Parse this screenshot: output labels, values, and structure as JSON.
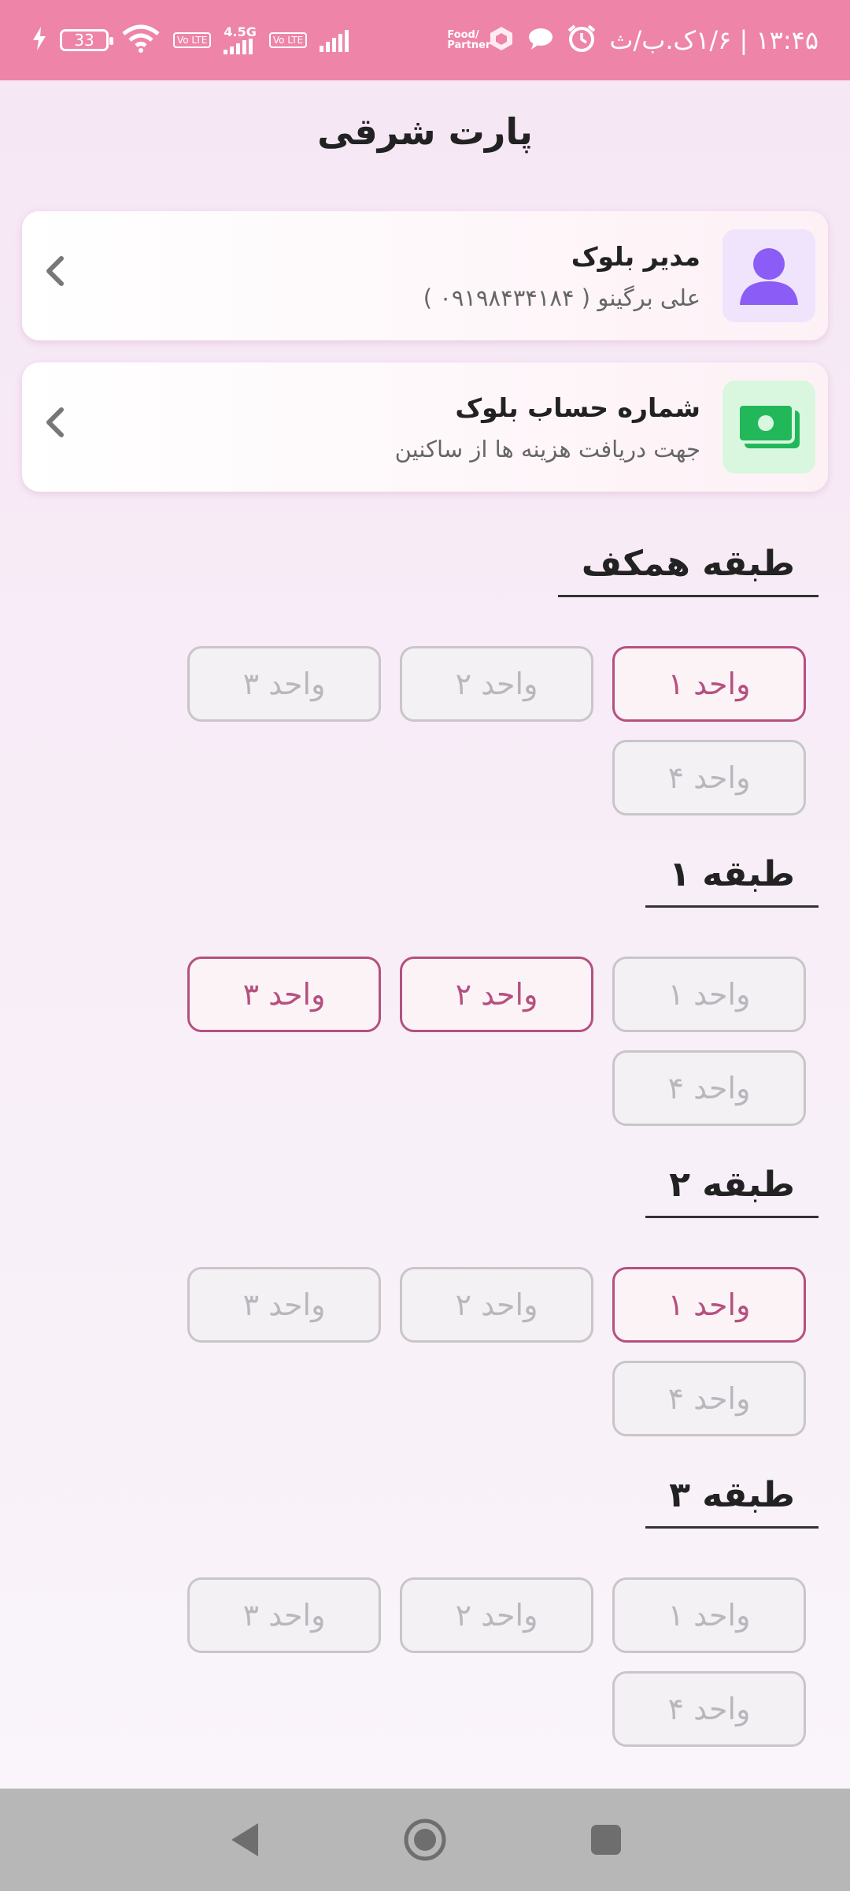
{
  "status_bar": {
    "time": "۱۳:۴۵ | ۱/۶ک.ب/ث",
    "battery": "33",
    "network": "4.5G",
    "volte": "Vo LTE",
    "food_label": "Food/ Partner",
    "icons": [
      "alarm-icon",
      "chat-icon",
      "hexagon-icon",
      "wifi-icon",
      "charging-icon"
    ]
  },
  "page": {
    "title": "پارت شرقی"
  },
  "cards": [
    {
      "title": "مدیر بلوک",
      "subtitle": "علی برگینو ( ۰۹۱۹۸۴۳۴۱۸۴ )",
      "icon": "person-icon",
      "icon_bg": "#efe4fb",
      "icon_color": "#8b5cf6"
    },
    {
      "title": "شماره حساب بلوک",
      "subtitle": "جهت دریافت هزینه ها از ساکنین",
      "icon": "money-icon",
      "icon_bg": "#d9f7df",
      "icon_color": "#22b85a"
    }
  ],
  "floors": [
    {
      "title": "طبقه همکف",
      "units": [
        {
          "label": "واحد ۱",
          "active": true
        },
        {
          "label": "واحد ۲",
          "active": false
        },
        {
          "label": "واحد ۳",
          "active": false
        },
        {
          "label": "واحد ۴",
          "active": false
        }
      ]
    },
    {
      "title": "طبقه ۱",
      "units": [
        {
          "label": "واحد ۱",
          "active": false
        },
        {
          "label": "واحد ۲",
          "active": true
        },
        {
          "label": "واحد ۳",
          "active": true
        },
        {
          "label": "واحد ۴",
          "active": false
        }
      ]
    },
    {
      "title": "طبقه ۲",
      "units": [
        {
          "label": "واحد ۱",
          "active": true
        },
        {
          "label": "واحد ۲",
          "active": false
        },
        {
          "label": "واحد ۳",
          "active": false
        },
        {
          "label": "واحد ۴",
          "active": false
        }
      ]
    },
    {
      "title": "طبقه ۳",
      "units": [
        {
          "label": "واحد ۱",
          "active": false
        },
        {
          "label": "واحد ۲",
          "active": false
        },
        {
          "label": "واحد ۳",
          "active": false
        },
        {
          "label": "واحد ۴",
          "active": false
        }
      ]
    }
  ],
  "colors": {
    "accent": "#b5507f",
    "status_bar": "#ee84a8",
    "nav_bar": "#b7b7b7"
  }
}
